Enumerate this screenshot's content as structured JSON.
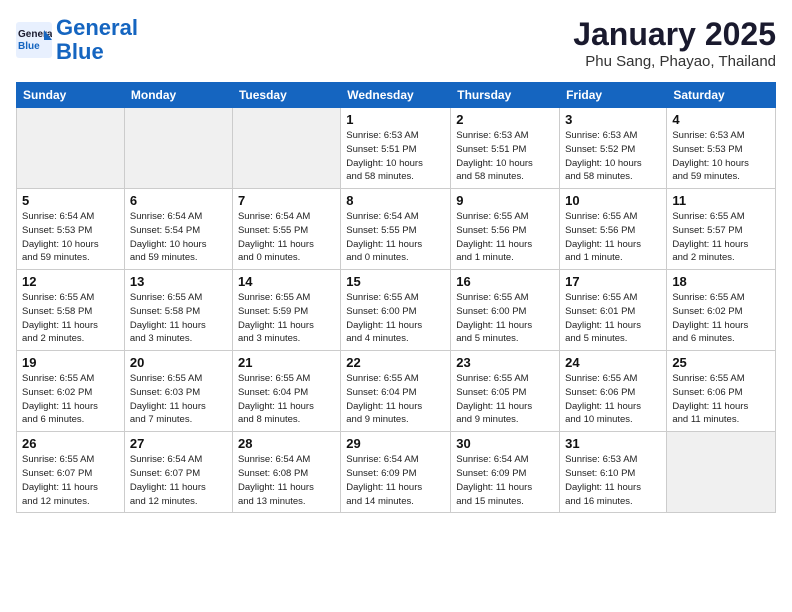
{
  "header": {
    "logo_line1": "General",
    "logo_line2": "Blue",
    "title": "January 2025",
    "subtitle": "Phu Sang, Phayao, Thailand"
  },
  "weekdays": [
    "Sunday",
    "Monday",
    "Tuesday",
    "Wednesday",
    "Thursday",
    "Friday",
    "Saturday"
  ],
  "weeks": [
    [
      {
        "num": "",
        "info": "",
        "empty": true
      },
      {
        "num": "",
        "info": "",
        "empty": true
      },
      {
        "num": "",
        "info": "",
        "empty": true
      },
      {
        "num": "1",
        "info": "Sunrise: 6:53 AM\nSunset: 5:51 PM\nDaylight: 10 hours\nand 58 minutes."
      },
      {
        "num": "2",
        "info": "Sunrise: 6:53 AM\nSunset: 5:51 PM\nDaylight: 10 hours\nand 58 minutes."
      },
      {
        "num": "3",
        "info": "Sunrise: 6:53 AM\nSunset: 5:52 PM\nDaylight: 10 hours\nand 58 minutes."
      },
      {
        "num": "4",
        "info": "Sunrise: 6:53 AM\nSunset: 5:53 PM\nDaylight: 10 hours\nand 59 minutes."
      }
    ],
    [
      {
        "num": "5",
        "info": "Sunrise: 6:54 AM\nSunset: 5:53 PM\nDaylight: 10 hours\nand 59 minutes."
      },
      {
        "num": "6",
        "info": "Sunrise: 6:54 AM\nSunset: 5:54 PM\nDaylight: 10 hours\nand 59 minutes."
      },
      {
        "num": "7",
        "info": "Sunrise: 6:54 AM\nSunset: 5:55 PM\nDaylight: 11 hours\nand 0 minutes."
      },
      {
        "num": "8",
        "info": "Sunrise: 6:54 AM\nSunset: 5:55 PM\nDaylight: 11 hours\nand 0 minutes."
      },
      {
        "num": "9",
        "info": "Sunrise: 6:55 AM\nSunset: 5:56 PM\nDaylight: 11 hours\nand 1 minute."
      },
      {
        "num": "10",
        "info": "Sunrise: 6:55 AM\nSunset: 5:56 PM\nDaylight: 11 hours\nand 1 minute."
      },
      {
        "num": "11",
        "info": "Sunrise: 6:55 AM\nSunset: 5:57 PM\nDaylight: 11 hours\nand 2 minutes."
      }
    ],
    [
      {
        "num": "12",
        "info": "Sunrise: 6:55 AM\nSunset: 5:58 PM\nDaylight: 11 hours\nand 2 minutes."
      },
      {
        "num": "13",
        "info": "Sunrise: 6:55 AM\nSunset: 5:58 PM\nDaylight: 11 hours\nand 3 minutes."
      },
      {
        "num": "14",
        "info": "Sunrise: 6:55 AM\nSunset: 5:59 PM\nDaylight: 11 hours\nand 3 minutes."
      },
      {
        "num": "15",
        "info": "Sunrise: 6:55 AM\nSunset: 6:00 PM\nDaylight: 11 hours\nand 4 minutes."
      },
      {
        "num": "16",
        "info": "Sunrise: 6:55 AM\nSunset: 6:00 PM\nDaylight: 11 hours\nand 5 minutes."
      },
      {
        "num": "17",
        "info": "Sunrise: 6:55 AM\nSunset: 6:01 PM\nDaylight: 11 hours\nand 5 minutes."
      },
      {
        "num": "18",
        "info": "Sunrise: 6:55 AM\nSunset: 6:02 PM\nDaylight: 11 hours\nand 6 minutes."
      }
    ],
    [
      {
        "num": "19",
        "info": "Sunrise: 6:55 AM\nSunset: 6:02 PM\nDaylight: 11 hours\nand 6 minutes."
      },
      {
        "num": "20",
        "info": "Sunrise: 6:55 AM\nSunset: 6:03 PM\nDaylight: 11 hours\nand 7 minutes."
      },
      {
        "num": "21",
        "info": "Sunrise: 6:55 AM\nSunset: 6:04 PM\nDaylight: 11 hours\nand 8 minutes."
      },
      {
        "num": "22",
        "info": "Sunrise: 6:55 AM\nSunset: 6:04 PM\nDaylight: 11 hours\nand 9 minutes."
      },
      {
        "num": "23",
        "info": "Sunrise: 6:55 AM\nSunset: 6:05 PM\nDaylight: 11 hours\nand 9 minutes."
      },
      {
        "num": "24",
        "info": "Sunrise: 6:55 AM\nSunset: 6:06 PM\nDaylight: 11 hours\nand 10 minutes."
      },
      {
        "num": "25",
        "info": "Sunrise: 6:55 AM\nSunset: 6:06 PM\nDaylight: 11 hours\nand 11 minutes."
      }
    ],
    [
      {
        "num": "26",
        "info": "Sunrise: 6:55 AM\nSunset: 6:07 PM\nDaylight: 11 hours\nand 12 minutes."
      },
      {
        "num": "27",
        "info": "Sunrise: 6:54 AM\nSunset: 6:07 PM\nDaylight: 11 hours\nand 12 minutes."
      },
      {
        "num": "28",
        "info": "Sunrise: 6:54 AM\nSunset: 6:08 PM\nDaylight: 11 hours\nand 13 minutes."
      },
      {
        "num": "29",
        "info": "Sunrise: 6:54 AM\nSunset: 6:09 PM\nDaylight: 11 hours\nand 14 minutes."
      },
      {
        "num": "30",
        "info": "Sunrise: 6:54 AM\nSunset: 6:09 PM\nDaylight: 11 hours\nand 15 minutes."
      },
      {
        "num": "31",
        "info": "Sunrise: 6:53 AM\nSunset: 6:10 PM\nDaylight: 11 hours\nand 16 minutes."
      },
      {
        "num": "",
        "info": "",
        "empty": true
      }
    ]
  ]
}
